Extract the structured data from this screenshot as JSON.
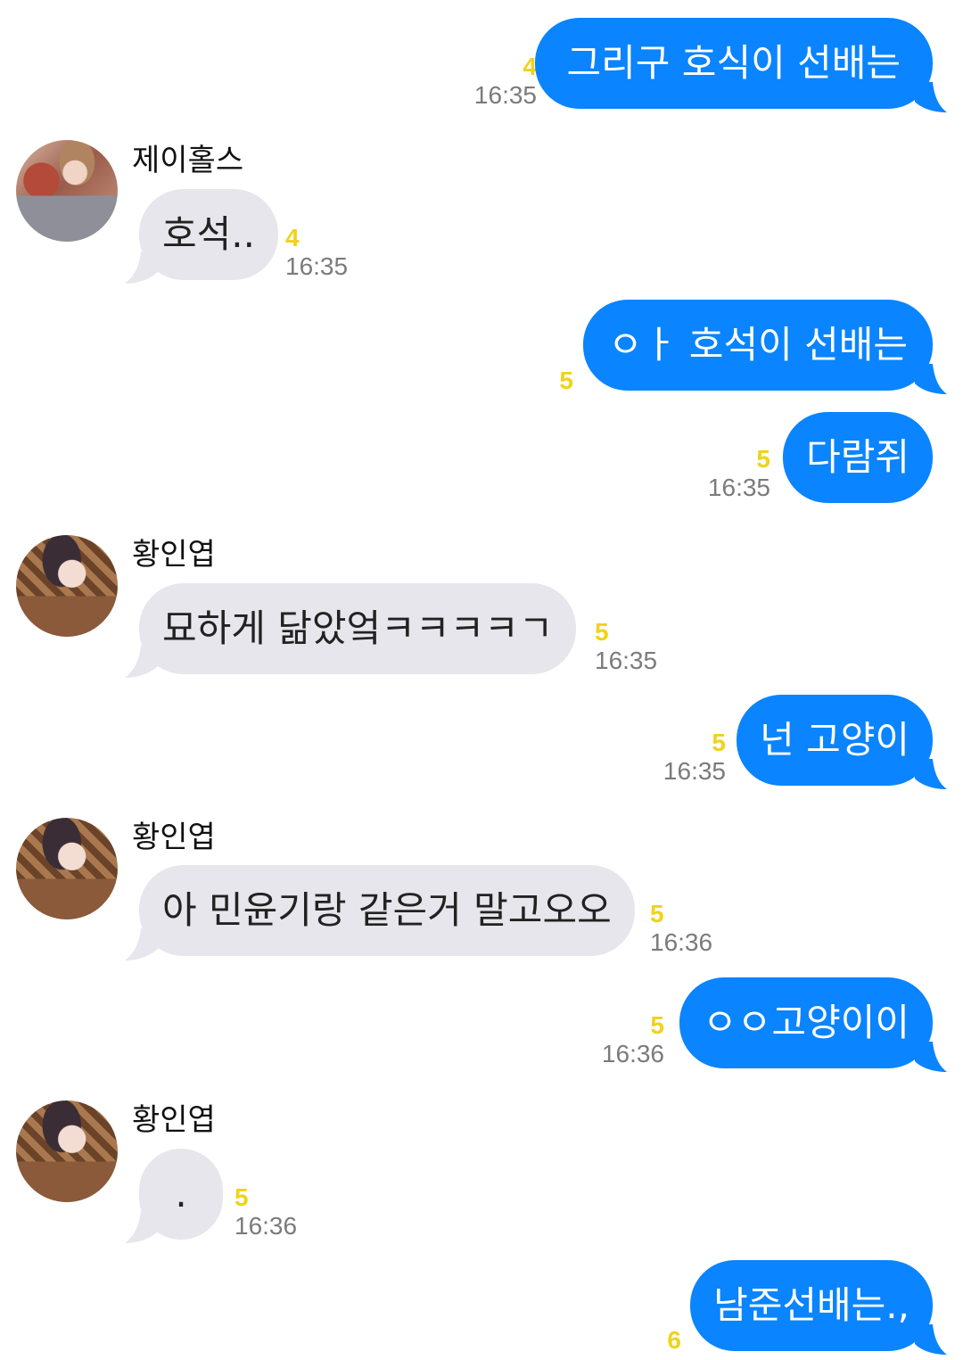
{
  "messages": [
    {
      "text": "그리구 호식이 선배는",
      "count": "4",
      "time": "16:35"
    },
    {
      "sender": "제이홀스",
      "avatar": "avatar-photo",
      "text": "호석..",
      "count": "4",
      "time": "16:35"
    },
    {
      "text": "ㅇㅏ 호석이 선배는",
      "count": "5"
    },
    {
      "text": "다람쥐",
      "count": "5",
      "time": "16:35"
    },
    {
      "sender": "황인엽",
      "avatar": "avatar-photo",
      "text": "묘하게 닮았엌ㅋㅋㅋㅋㄱ",
      "count": "5",
      "time": "16:35"
    },
    {
      "text": "넌 고양이",
      "count": "5",
      "time": "16:35"
    },
    {
      "sender": "황인엽",
      "avatar": "avatar-photo",
      "text": "아 민윤기랑 같은거 말고오오",
      "count": "5",
      "time": "16:36"
    },
    {
      "text": "ㅇㅇ고양이이",
      "count": "5",
      "time": "16:36"
    },
    {
      "sender": "황인엽",
      "avatar": "avatar-photo",
      "text": ".",
      "count": "5",
      "time": "16:36"
    },
    {
      "text": "남준선배는.,",
      "count": "6"
    }
  ],
  "colors": {
    "outgoing_bubble": "#0a84ff",
    "incoming_bubble": "#e6e6ec",
    "unread_count": "#f0d21c",
    "timestamp": "#7b7b7b"
  }
}
